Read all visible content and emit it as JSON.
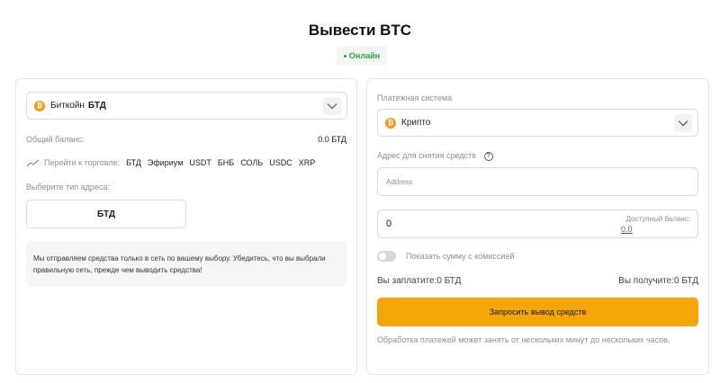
{
  "page": {
    "title": "Вывести BTC",
    "status": "Онлайн"
  },
  "colors": {
    "accent": "#f5a60a",
    "status_green": "#2e9e48",
    "coin_orange": "#f39a26"
  },
  "left": {
    "currency_select": {
      "icon": "bitcoin-coin-icon",
      "name": "Биткойн",
      "ticker": "БТД"
    },
    "balance_label": "Общий баланс:",
    "balance_value": "0.0 БТД",
    "trade_label": "Перейти к торговле:",
    "trade_tickers": [
      "БТД",
      "Эфириум",
      "USDT",
      "БНБ",
      "СОЛЬ",
      "USDC",
      "XRP"
    ],
    "address_type_label": "Выберите тип адреса:",
    "address_type_button": "БТД",
    "notice": "Мы отправляем средства только в сеть по вашему выбору. Убедитесь, что вы выбрали правильную сеть, прежде чем выводить средства!"
  },
  "right": {
    "payment_system_label": "Платежная система",
    "payment_system_value": "Крипто",
    "address_label": "Адрес для снятия средств",
    "address_placeholder": "Address",
    "amount_value": "0",
    "available_label": "Доступный баланс:",
    "available_value": "0.0",
    "fee_toggle_label": "Показать сумму с комиссией",
    "you_pay": "Вы заплатите:0 БТД",
    "you_receive": "Вы получите:0 БТД",
    "submit_label": "Запросить вывод средств",
    "processing_note": "Обработка платежей может занять от нескольких минут до нескольких часов."
  }
}
